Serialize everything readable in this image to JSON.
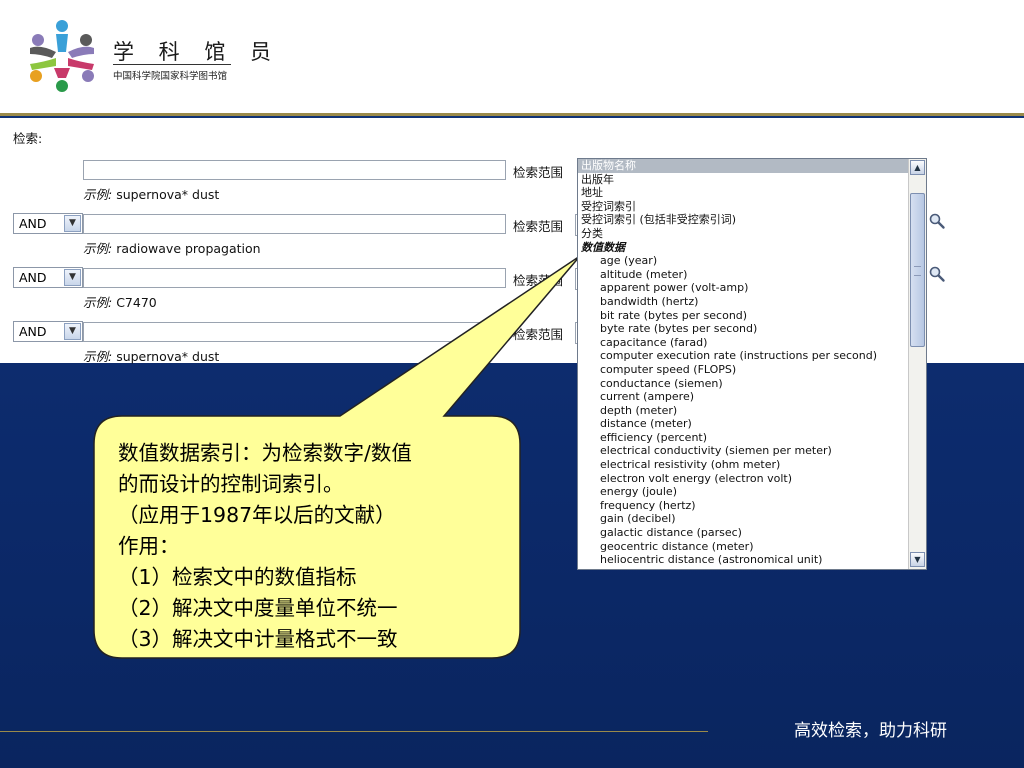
{
  "brand": {
    "title": "学 科 馆 员",
    "subtitle": "中国科学院国家科学图书馆"
  },
  "form": {
    "search_label": "检索:",
    "range_label": "检索范围",
    "rows": [
      {
        "operator": "",
        "example_prefix": "示例:",
        "example": " supernova* dust"
      },
      {
        "operator": "AND",
        "example_prefix": "示例:",
        "example": " radiowave propagation"
      },
      {
        "operator": "AND",
        "example_prefix": "示例:",
        "example": " C7470"
      },
      {
        "operator": "AND",
        "example_prefix": "示例:",
        "example": " supernova* dust"
      }
    ]
  },
  "listbox": {
    "items": [
      "出版物名称",
      "出版年",
      "地址",
      "受控词索引",
      "受控词索引 (包括非受控索引词)",
      "分类",
      "数值数据",
      "age (year)",
      "altitude (meter)",
      "apparent power (volt-amp)",
      "bandwidth (hertz)",
      "bit rate (bytes per second)",
      "byte rate (bytes per second)",
      "capacitance (farad)",
      "computer execution rate (instructions per second)",
      "computer speed (FLOPS)",
      "conductance (siemen)",
      "current (ampere)",
      "depth (meter)",
      "distance (meter)",
      "efficiency (percent)",
      "electrical conductivity (siemen per meter)",
      "electrical resistivity (ohm meter)",
      "electron volt energy (electron volt)",
      "energy (joule)",
      "frequency (hertz)",
      "gain (decibel)",
      "galactic distance (parsec)",
      "geocentric distance (meter)",
      "heliocentric distance (astronomical unit)"
    ]
  },
  "callout": {
    "lines": [
      "数值数据索引：为检索数字/数值",
      "的而设计的控制词索引。",
      "（应用于1987年以后的文献）",
      "作用：",
      "（1）检索文中的数值指标",
      "（2）解决文中度量单位不统一",
      "（3）解决文中计量格式不一致"
    ]
  },
  "footer": {
    "slogan": "高效检索，助力科研"
  },
  "colors": {
    "background_blue": "#0e2c6b",
    "callout_fill": "#ffff99",
    "header_rule": "#9a8a4a",
    "selected_item": "#b2bac4"
  }
}
